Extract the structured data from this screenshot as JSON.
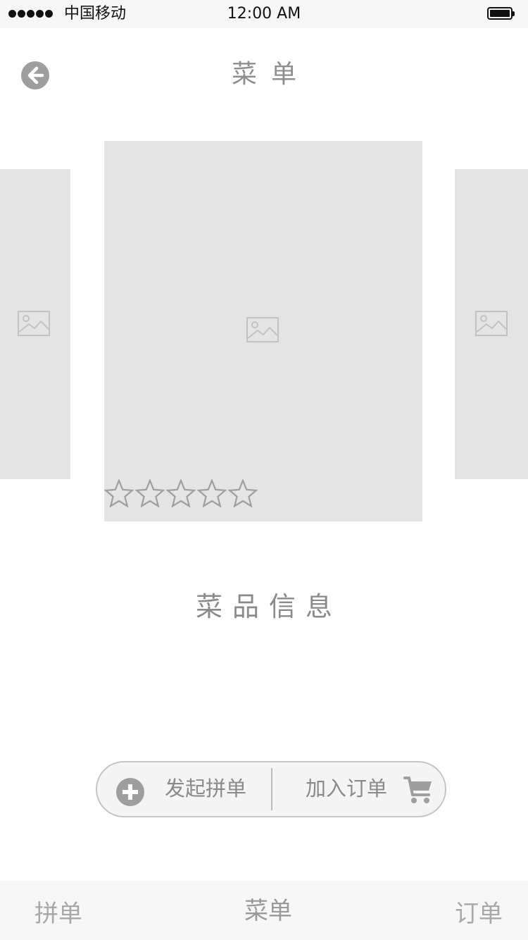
{
  "status_bar": {
    "carrier": "中国移动",
    "time": "12:00 AM"
  },
  "nav": {
    "title": "菜单",
    "back_icon": "arrow-left-circle-icon"
  },
  "carousel": {
    "slide_icon": "image-placeholder-icon",
    "rating": {
      "value": 0,
      "max": 5
    }
  },
  "dish": {
    "info": "菜品信息"
  },
  "actions": {
    "start_group": {
      "label": "发起拼单",
      "icon": "plus-circle-icon"
    },
    "add_order": {
      "label": "加入订单",
      "icon": "shopping-cart-icon"
    }
  },
  "tabs": [
    {
      "label": "拼单"
    },
    {
      "label": "菜单"
    },
    {
      "label": "订单"
    }
  ],
  "colors": {
    "placeholder": "#e4e4e4",
    "icon_gray": "#9e9e9e",
    "text_gray": "#8a8a8a",
    "bar_bg": "#f7f7f7"
  }
}
